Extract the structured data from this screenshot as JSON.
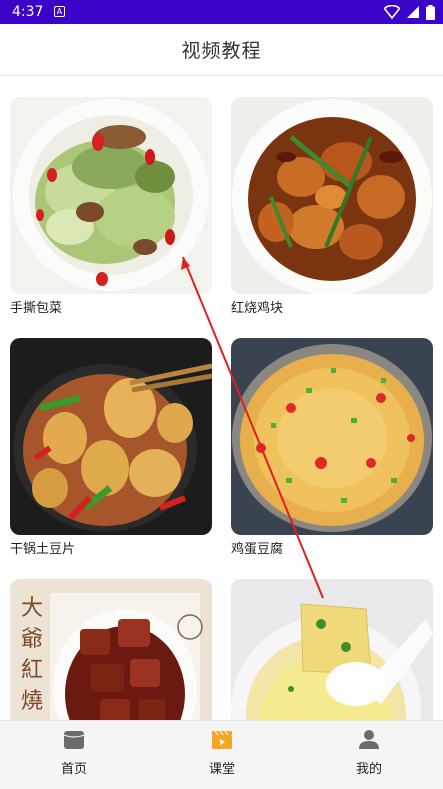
{
  "status_bar": {
    "time": "4:37",
    "notification_letter": "A",
    "icons": [
      "wifi-icon",
      "signal-icon",
      "battery-icon"
    ],
    "color": "#3b05c9"
  },
  "header": {
    "title": "视频教程"
  },
  "videos": [
    {
      "title": "手撕包菜",
      "thumbnail": "cabbage-dish"
    },
    {
      "title": "红烧鸡块",
      "thumbnail": "braised-chicken-dish"
    },
    {
      "title": "干锅土豆片",
      "thumbnail": "potato-slices-dish"
    },
    {
      "title": "鸡蛋豆腐",
      "thumbnail": "egg-tofu-dish"
    },
    {
      "title": "",
      "thumbnail": "braised-pork-dish"
    },
    {
      "title": "",
      "thumbnail": "steamed-egg-tofu-dish"
    }
  ],
  "thumbnail_text": {
    "braised_pork_calligraphy": "大爺紅燒"
  },
  "bottom_nav": {
    "items": [
      {
        "label": "首页",
        "icon": "home-icon"
      },
      {
        "label": "课堂",
        "icon": "video-clapper-icon"
      },
      {
        "label": "我的",
        "icon": "profile-icon"
      }
    ]
  },
  "colors": {
    "accent": "#3b05c9",
    "annotation_arrow": "#e02020",
    "clapper": "#f5a623"
  }
}
